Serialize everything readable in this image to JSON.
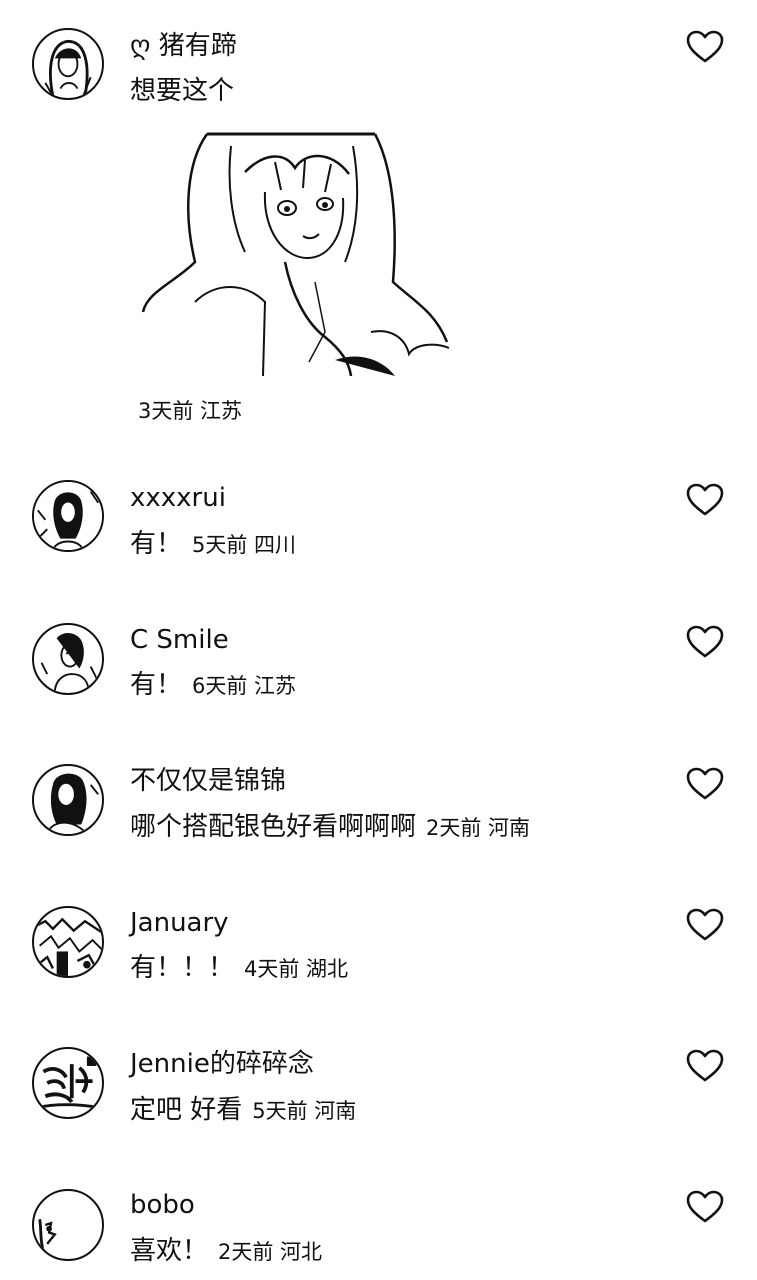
{
  "comments": [
    {
      "username": "ღ 猪有蹄",
      "text": "想要这个",
      "meta": "3天前 江苏",
      "has_sticker": true,
      "avatar_icon": "avatar-woman-long-hair-icon",
      "like_icon": "heart-outline-icon"
    },
    {
      "username": "xxxxrui",
      "text": "有！",
      "meta": "5天前 四川",
      "avatar_icon": "avatar-woman-icon",
      "like_icon": "heart-outline-icon"
    },
    {
      "username": "C Smile",
      "text": "有！",
      "meta": "6天前 江苏",
      "avatar_icon": "avatar-woman-icon",
      "like_icon": "heart-outline-icon"
    },
    {
      "username": "不仅仅是锦锦",
      "text": "哪个搭配银色好看啊啊啊",
      "meta": "2天前 河南",
      "avatar_icon": "avatar-woman-icon",
      "like_icon": "heart-outline-icon"
    },
    {
      "username": "January",
      "text": "有！！！",
      "meta": "4天前 湖北",
      "avatar_icon": "avatar-scenery-icon",
      "like_icon": "heart-outline-icon"
    },
    {
      "username": "Jennie的碎碎念",
      "text": "定吧 好看",
      "meta": "5天前 河南",
      "avatar_icon": "avatar-calligraphy-icon",
      "like_icon": "heart-outline-icon"
    },
    {
      "username": "bobo",
      "text": "喜欢！",
      "meta": "2天前 河北",
      "avatar_icon": "avatar-sketch-icon",
      "like_icon": "heart-outline-icon"
    }
  ]
}
